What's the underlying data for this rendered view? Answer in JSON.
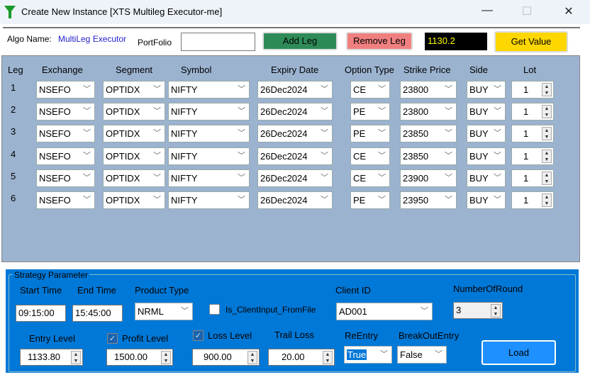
{
  "window": {
    "title": "Create New Instance [XTS Multileg Executor-me]",
    "icon": "funnel-icon"
  },
  "top": {
    "algo_label": "Algo Name:",
    "algo_value": "MultiLeg Executor",
    "portfolio_label": "PortFolio",
    "portfolio_value": "",
    "add_leg": "Add Leg",
    "remove_leg": "Remove Leg",
    "value_display": "1130.2",
    "get_value": "Get Value",
    "colors": {
      "add": "#2e8b57",
      "remove": "#f08080",
      "display": "#000000",
      "get": "#ffd700"
    }
  },
  "grid": {
    "headers": [
      "Leg",
      "Exchange",
      "Segment",
      "Symbol",
      "Expiry Date",
      "Option Type",
      "Strike Price",
      "Side",
      "Lot"
    ],
    "rows": [
      {
        "leg": "1",
        "exchange": "NSEFO",
        "segment": "OPTIDX",
        "symbol": "NIFTY",
        "expiry": "26Dec2024",
        "option_type": "CE",
        "strike": "23800",
        "side": "BUY",
        "lot": "1"
      },
      {
        "leg": "2",
        "exchange": "NSEFO",
        "segment": "OPTIDX",
        "symbol": "NIFTY",
        "expiry": "26Dec2024",
        "option_type": "PE",
        "strike": "23800",
        "side": "BUY",
        "lot": "1"
      },
      {
        "leg": "3",
        "exchange": "NSEFO",
        "segment": "OPTIDX",
        "symbol": "NIFTY",
        "expiry": "26Dec2024",
        "option_type": "PE",
        "strike": "23850",
        "side": "BUY",
        "lot": "1"
      },
      {
        "leg": "4",
        "exchange": "NSEFO",
        "segment": "OPTIDX",
        "symbol": "NIFTY",
        "expiry": "26Dec2024",
        "option_type": "CE",
        "strike": "23850",
        "side": "BUY",
        "lot": "1"
      },
      {
        "leg": "5",
        "exchange": "NSEFO",
        "segment": "OPTIDX",
        "symbol": "NIFTY",
        "expiry": "26Dec2024",
        "option_type": "CE",
        "strike": "23900",
        "side": "BUY",
        "lot": "1"
      },
      {
        "leg": "6",
        "exchange": "NSEFO",
        "segment": "OPTIDX",
        "symbol": "NIFTY",
        "expiry": "26Dec2024",
        "option_type": "PE",
        "strike": "23950",
        "side": "BUY",
        "lot": "1"
      }
    ]
  },
  "strategy": {
    "legend": "Strategy Parameter",
    "start_time_label": "Start Time",
    "start_time": "09:15:00",
    "end_time_label": "End Time",
    "end_time": "15:45:00",
    "product_type_label": "Product Type",
    "product_type": "NRML",
    "client_input_label": "Is_ClientInput_FromFile",
    "client_input_checked": false,
    "client_id_label": "Client ID",
    "client_id": "AD001",
    "rounds_label": "NumberOfRound",
    "rounds": "3",
    "entry_label": "Entry Level",
    "entry": "1133.80",
    "profit_label": "Profit Level",
    "profit_checked": true,
    "profit": "1500.00",
    "loss_label": "Loss Level",
    "loss_checked": true,
    "loss": "900.00",
    "trail_label": "Trail Loss",
    "trail": "20.00",
    "reentry_label": "ReEntry",
    "reentry": "True",
    "breakout_label": "BreakOutEntry",
    "breakout": "False",
    "load": "Load"
  }
}
